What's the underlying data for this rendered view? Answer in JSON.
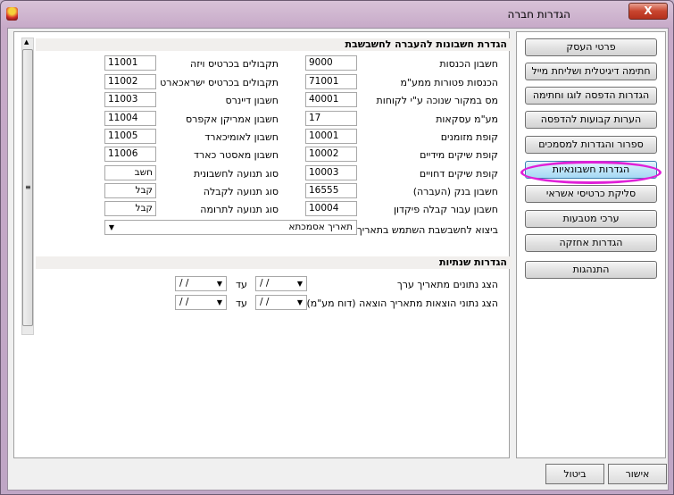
{
  "window": {
    "title": "הגדרות חברה",
    "close_label": "X"
  },
  "accounting": {
    "section_title": "הגדרת חשבונות להעברה לחשבשבת",
    "right_column": [
      {
        "label": "חשבון הכנסות",
        "value": "9000"
      },
      {
        "label": "הכנסות פטורות ממע\"מ",
        "value": "71001"
      },
      {
        "label": "מס במקור שנוכה ע\"י לקוחות",
        "value": "40001"
      },
      {
        "label": "מע\"מ עסקאות",
        "value": "17"
      },
      {
        "label": "קופת מזומנים",
        "value": "10001"
      },
      {
        "label": "קופת שיקים מידיים",
        "value": "10002"
      },
      {
        "label": "קופת שיקים דחויים",
        "value": "10003"
      },
      {
        "label": "חשבון בנק (העברה)",
        "value": "16555"
      },
      {
        "label": "חשבון עבור קבלה פיקדון",
        "value": "10004"
      }
    ],
    "left_column": [
      {
        "label": "תקבולים בכרטיס ויזה",
        "value": "11001"
      },
      {
        "label": "תקבולים בכרטיס ישראכארט",
        "value": "11002"
      },
      {
        "label": "חשבון דיינרס",
        "value": "11003"
      },
      {
        "label": "חשבון אמריקן אקפרס",
        "value": "11004"
      },
      {
        "label": "חשבון לאומיכארד",
        "value": "11005"
      },
      {
        "label": "חשבון מאסטר כארד",
        "value": "11006"
      },
      {
        "label": "סוג תנועה לחשבונית",
        "value": "חשב"
      },
      {
        "label": "סוג תנועה לקבלה",
        "value": "קבל"
      },
      {
        "label": "סוג תנועה לתרומה",
        "value": "קבל"
      }
    ],
    "export_date_label": "ביצוא לחשבשבת השתמש בתאריך",
    "export_date_value": "תאריך אסמכתא"
  },
  "annual": {
    "section_title": "הגדרות שנתיות",
    "rows": [
      {
        "label": "הצג נתונים מתאריך ערך",
        "from": "/ /",
        "to_label": "עד",
        "to": "/ /"
      },
      {
        "label": "הצג נתוני הוצאות מתאריך הוצאה (דוח מע\"מ)",
        "from": "/ /",
        "to_label": "עד",
        "to": "/ /"
      }
    ]
  },
  "nav": {
    "items": [
      "פרטי העסק",
      "חתימה דיגיטלית ושליחת מייל",
      "הגדרות הדפסה לוגו וחתימה",
      "הערות קבועות להדפסה",
      "ספרור והגדרות למסמכים",
      "הגדרות חשבונאיות",
      "סליקת כרטיסי אשראי",
      "ערכי מטבעות",
      "הגדרות אחזקה",
      "התנהגות"
    ],
    "active_index": 5,
    "highlight_color": "#e020d8"
  },
  "footer": {
    "ok_label": "אישור",
    "cancel_label": "ביטול"
  }
}
